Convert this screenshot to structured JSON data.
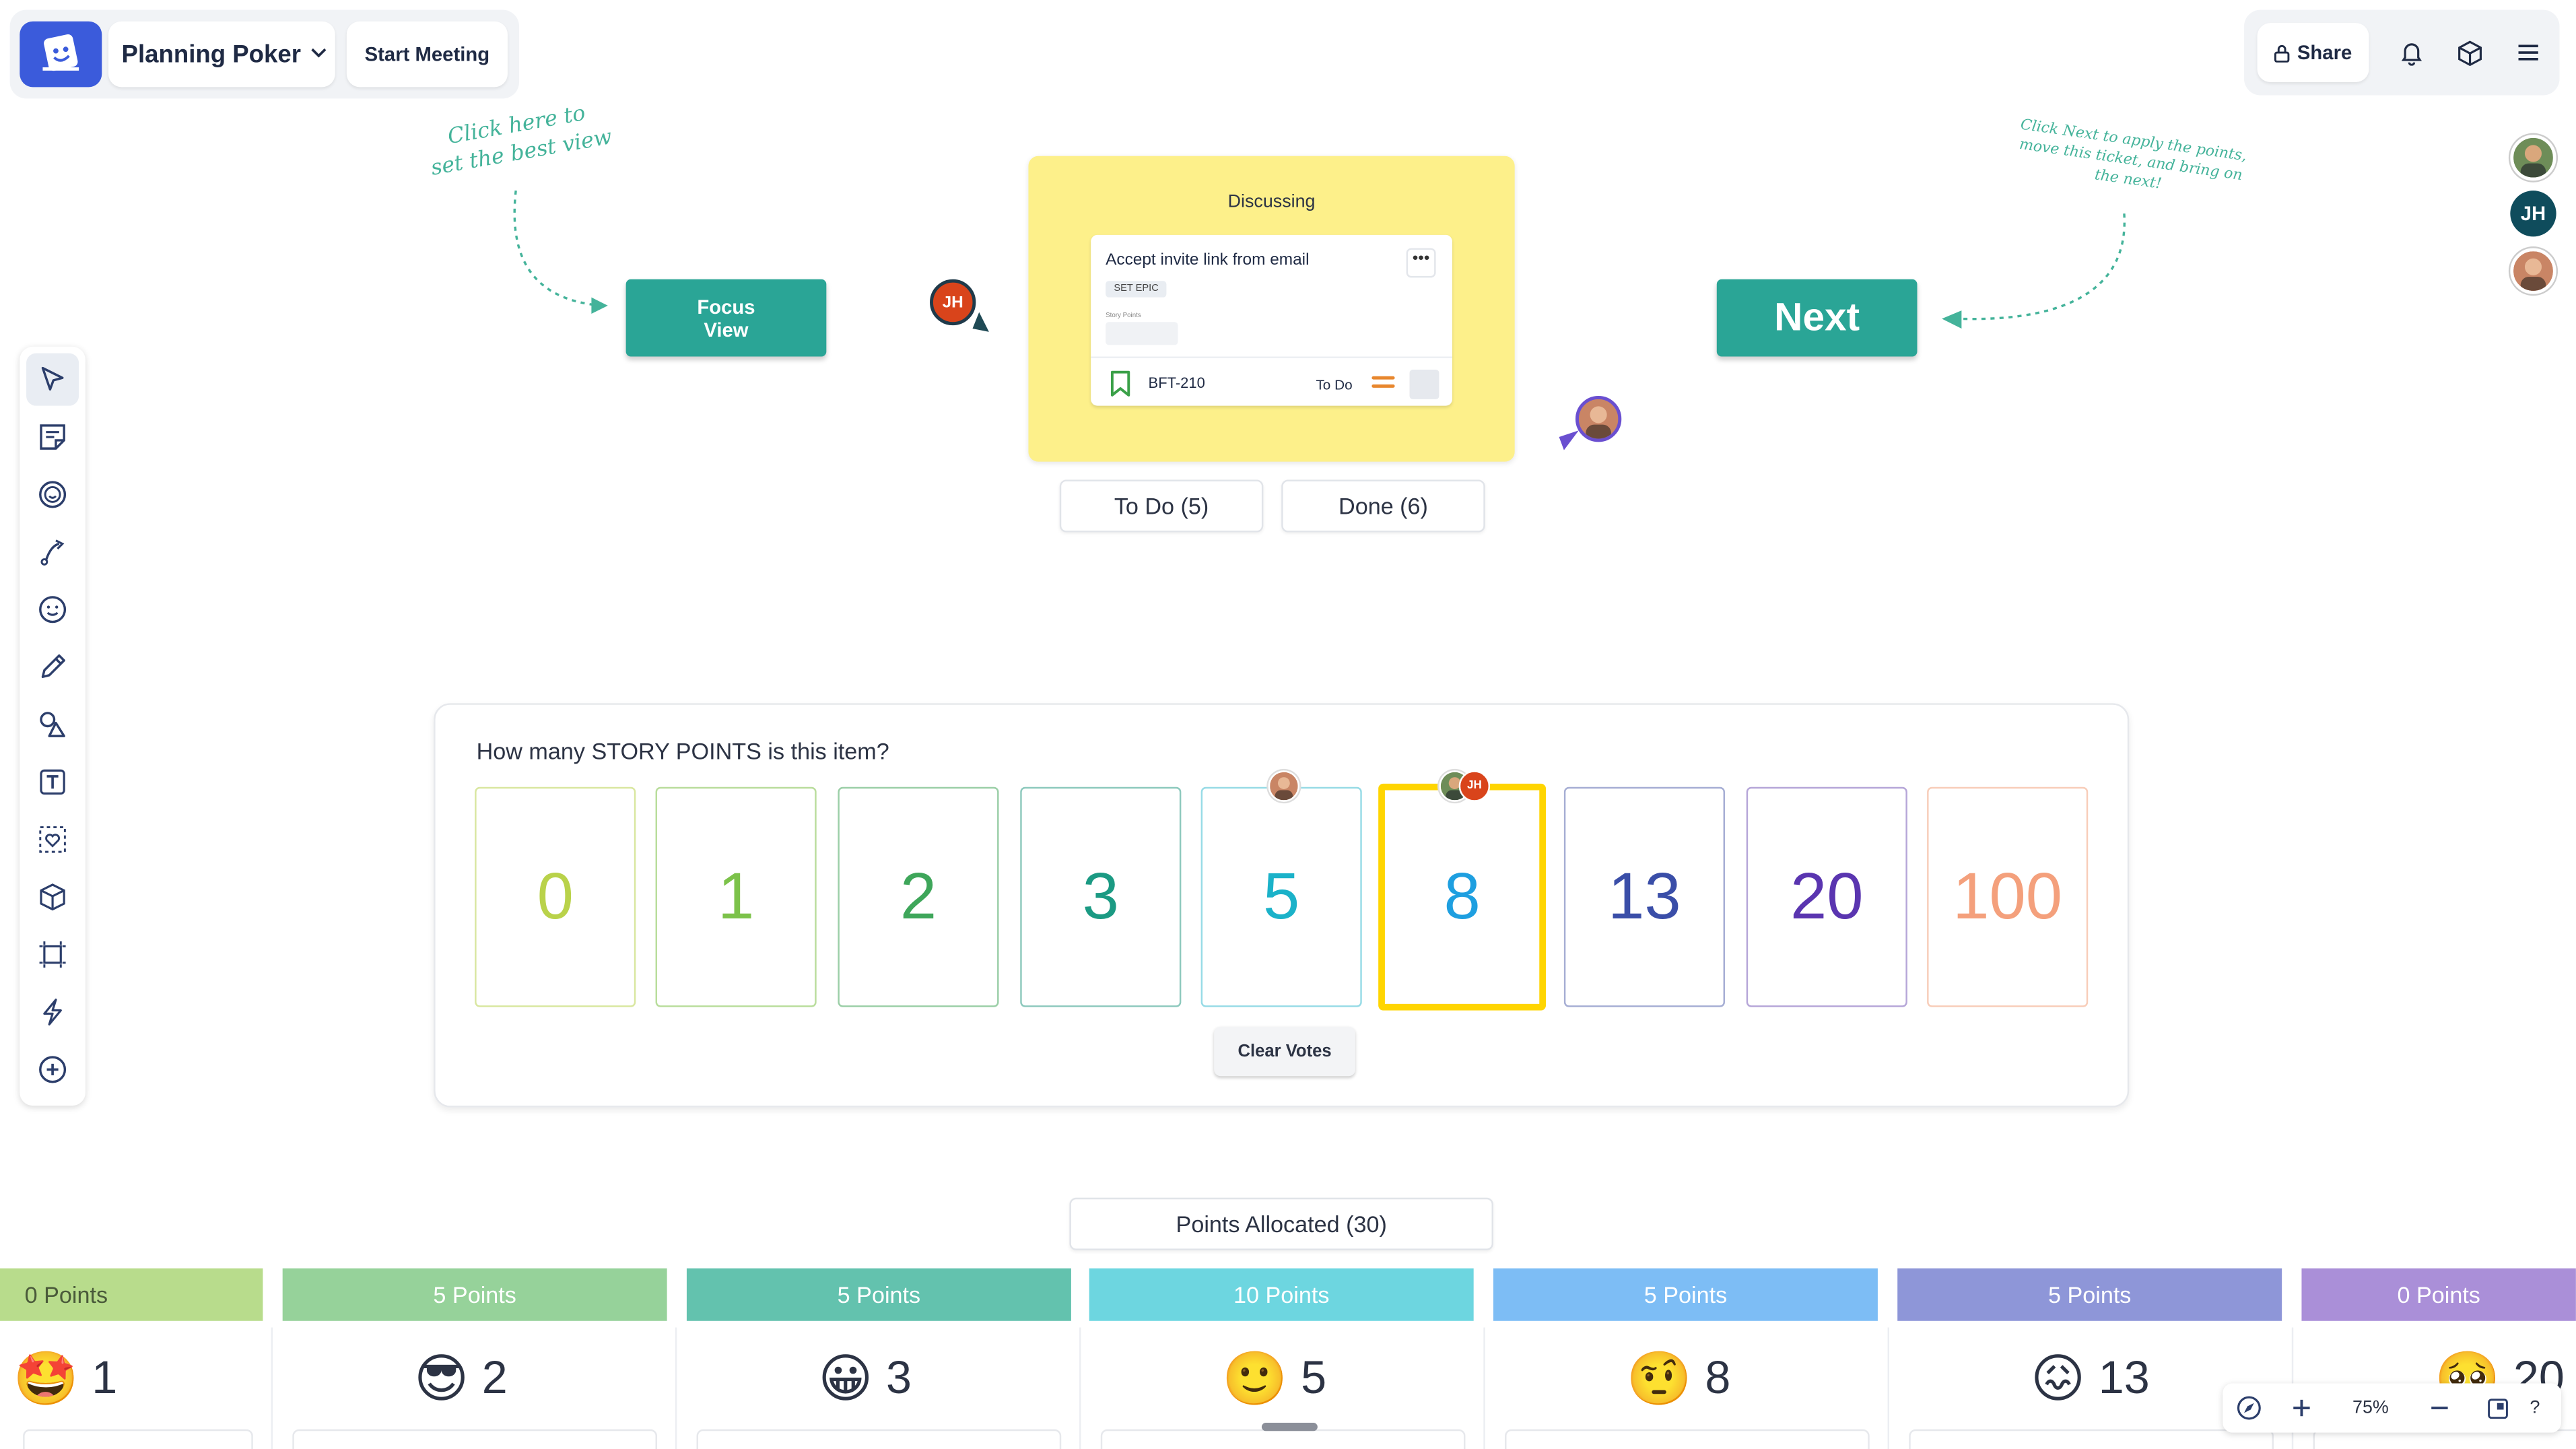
{
  "header": {
    "board_name": "Planning Poker",
    "start_meeting_label": "Start Meeting",
    "share_label": "Share"
  },
  "participants": [
    {
      "initials": "",
      "color": "#5a7a4a"
    },
    {
      "initials": "JH",
      "color": "#0f4c5c"
    },
    {
      "initials": "",
      "color": "#b8553a"
    }
  ],
  "annotations": {
    "focus_hint": "Click here to\nset the best view",
    "next_hint": "Click Next to apply the points,\nmove this ticket, and bring on\nthe next!"
  },
  "focus_button_label": "Focus\nView",
  "next_button_label": "Next",
  "cursor_initials": "JH",
  "discussing": {
    "title": "Discussing",
    "ticket": {
      "title": "Accept invite link from email",
      "more": "•••",
      "epic": "SET EPIC",
      "story_points_label": "Story Points",
      "key": "BFT-210",
      "status": "To Do"
    }
  },
  "tabs": {
    "todo": "To Do (5)",
    "done": "Done (6)"
  },
  "voting": {
    "question": "How many STORY POINTS is this item?",
    "cards": [
      {
        "value": "0",
        "color": "#b9d24a",
        "border": "#d9e7a0",
        "selected": false
      },
      {
        "value": "1",
        "color": "#7cc24a",
        "border": "#b9dd9c",
        "selected": false
      },
      {
        "value": "2",
        "color": "#3ea65a",
        "border": "#9bcfa7",
        "selected": false
      },
      {
        "value": "3",
        "color": "#1b9a83",
        "border": "#8dc9bd",
        "selected": false
      },
      {
        "value": "5",
        "color": "#1bb2c9",
        "border": "#97dbe6",
        "selected": false
      },
      {
        "value": "8",
        "color": "#1e9fe0",
        "border": "#ffd500",
        "selected": true
      },
      {
        "value": "13",
        "color": "#3a4ea8",
        "border": "#a6aed4",
        "selected": false
      },
      {
        "value": "20",
        "color": "#5a35b0",
        "border": "#b6a6d8",
        "selected": false
      },
      {
        "value": "100",
        "color": "#f4a07c",
        "border": "#f8cdb9",
        "selected": false
      }
    ],
    "voter_initials": "JH",
    "clear_label": "Clear Votes"
  },
  "allocated_label": "Points Allocated (30)",
  "point_bars": [
    {
      "label": "0 Points",
      "color": "#b8dc8c",
      "text": "#4a5a3a"
    },
    {
      "label": "5 Points",
      "color": "#96d29a",
      "text": "#ffffff"
    },
    {
      "label": "5 Points",
      "color": "#63c2ae",
      "text": "#ffffff"
    },
    {
      "label": "10 Points",
      "color": "#6dd6e0",
      "text": "#ffffff"
    },
    {
      "label": "5 Points",
      "color": "#7dbdf5",
      "text": "#ffffff"
    },
    {
      "label": "5 Points",
      "color": "#8e96d8",
      "text": "#ffffff"
    },
    {
      "label": "0 Points",
      "color": "#aa8fd8",
      "text": "#ffffff"
    }
  ],
  "columns": [
    {
      "emoji": "🤩",
      "value": "1"
    },
    {
      "emoji": "😎",
      "value": "2"
    },
    {
      "emoji": "😀",
      "value": "3"
    },
    {
      "emoji": "🙂",
      "value": "5"
    },
    {
      "emoji": "🤨",
      "value": "8"
    },
    {
      "emoji": "😖",
      "value": "13"
    },
    {
      "emoji": "🥺",
      "value": "20"
    }
  ],
  "zoom": {
    "level": "75%",
    "help": "?"
  }
}
